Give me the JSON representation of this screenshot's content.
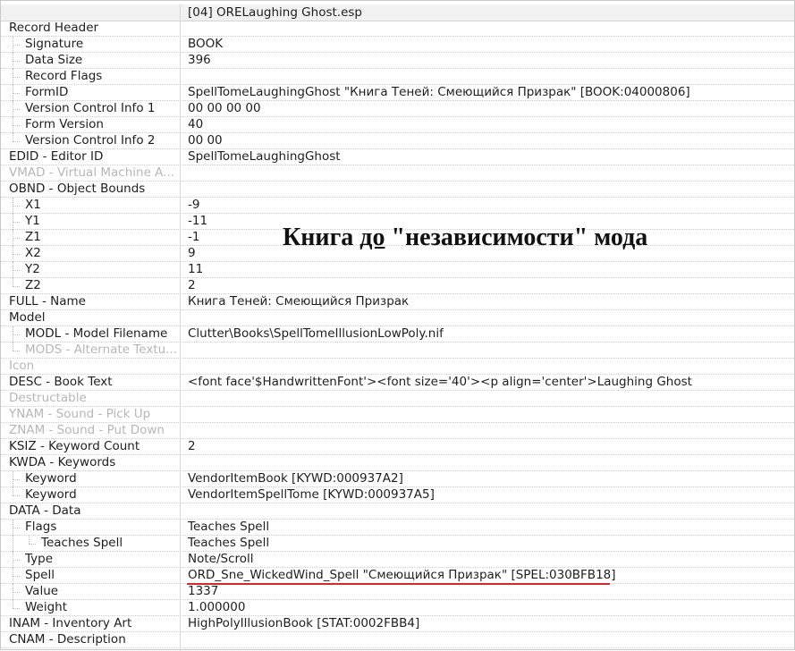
{
  "window": {
    "title": "[04] ORELaughing Ghost.esp"
  },
  "overlay": {
    "before": "Книга ",
    "underlined": "до",
    "after": " \"независимости\" мода"
  },
  "rows": [
    {
      "label": "Record Header",
      "value": ""
    },
    {
      "label": "Signature",
      "value": "BOOK"
    },
    {
      "label": "Data Size",
      "value": "396"
    },
    {
      "label": "Record Flags",
      "value": ""
    },
    {
      "label": "FormID",
      "value": "SpellTomeLaughingGhost \"Книга Теней: Смеющийся Призрак\" [BOOK:04000806]"
    },
    {
      "label": "Version Control Info 1",
      "value": "00 00 00 00"
    },
    {
      "label": "Form Version",
      "value": "40"
    },
    {
      "label": "Version Control Info 2",
      "value": "00 00"
    },
    {
      "label": "EDID - Editor ID",
      "value": "SpellTomeLaughingGhost"
    },
    {
      "label": "VMAD - Virtual Machine A...",
      "value": ""
    },
    {
      "label": "OBND - Object Bounds",
      "value": ""
    },
    {
      "label": "X1",
      "value": "-9"
    },
    {
      "label": "Y1",
      "value": "-11"
    },
    {
      "label": "Z1",
      "value": "-1"
    },
    {
      "label": "X2",
      "value": "9"
    },
    {
      "label": "Y2",
      "value": "11"
    },
    {
      "label": "Z2",
      "value": "2"
    },
    {
      "label": "FULL - Name",
      "value": "Книга Теней: Смеющийся Призрак"
    },
    {
      "label": "Model",
      "value": ""
    },
    {
      "label": "MODL - Model Filename",
      "value": "Clutter\\Books\\SpellTomeIllusionLowPoly.nif"
    },
    {
      "label": "MODS - Alternate Textu...",
      "value": ""
    },
    {
      "label": "Icon",
      "value": ""
    },
    {
      "label": "DESC - Book Text",
      "value": "<font face'$HandwrittenFont'><font size='40'><p align='center'>Laughing Ghost"
    },
    {
      "label": "Destructable",
      "value": ""
    },
    {
      "label": "YNAM - Sound - Pick Up",
      "value": ""
    },
    {
      "label": "ZNAM - Sound - Put Down",
      "value": ""
    },
    {
      "label": "KSIZ - Keyword Count",
      "value": "2"
    },
    {
      "label": "KWDA - Keywords",
      "value": ""
    },
    {
      "label": "Keyword",
      "value": "VendorItemBook [KYWD:000937A2]"
    },
    {
      "label": "Keyword",
      "value": "VendorItemSpellTome [KYWD:000937A5]"
    },
    {
      "label": "DATA - Data",
      "value": ""
    },
    {
      "label": "Flags",
      "value": "Teaches Spell"
    },
    {
      "label": "Teaches Spell",
      "value": "Teaches Spell"
    },
    {
      "label": "Type",
      "value": "Note/Scroll"
    },
    {
      "label": "Spell",
      "value": "ORD_Sne_WickedWind_Spell \"Смеющийся Призрак\" [SPEL:030BFB18]"
    },
    {
      "label": "Value",
      "value": "1337"
    },
    {
      "label": "Weight",
      "value": "1.000000"
    },
    {
      "label": "INAM - Inventory Art",
      "value": "HighPolyIllusionBook [STAT:0002FBB4]"
    },
    {
      "label": "CNAM - Description",
      "value": ""
    }
  ]
}
